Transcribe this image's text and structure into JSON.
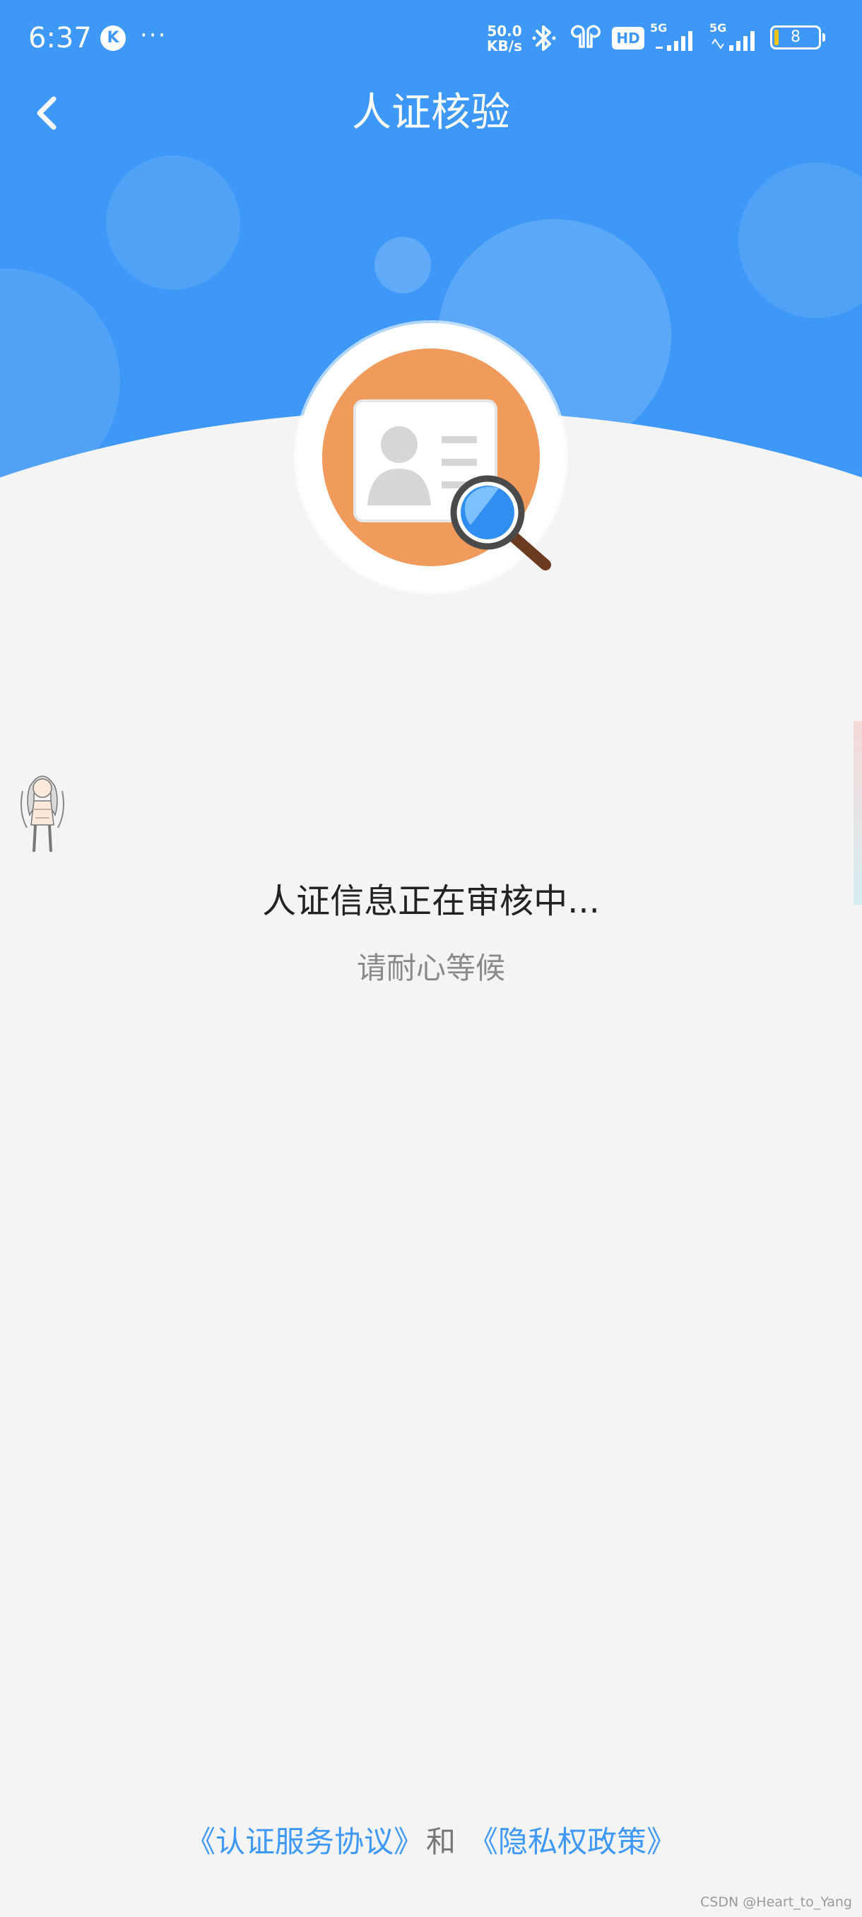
{
  "status_bar": {
    "time": "6:37",
    "k_badge": "K",
    "more": "···",
    "net_speed_value": "50.0",
    "net_speed_unit": "KB/s",
    "hd_badge": "HD",
    "signal_1_label": "5G",
    "signal_2_label": "5G",
    "battery_level": "8"
  },
  "header": {
    "title": "人证核验",
    "back_icon": "chevron-left-icon",
    "background_color": "#3d98f7"
  },
  "emblem": {
    "icon": "id-card-magnifier-icon",
    "circle_color": "#f09a5c"
  },
  "status": {
    "title": "人证信息正在审核中...",
    "subtitle": "请耐心等候"
  },
  "footer": {
    "service_agreement": "《认证服务协议》",
    "and_text": "和",
    "privacy_policy": "《隐私权政策》",
    "link_color": "#3d98f7"
  },
  "watermark": "CSDN @Heart_to_Yang"
}
